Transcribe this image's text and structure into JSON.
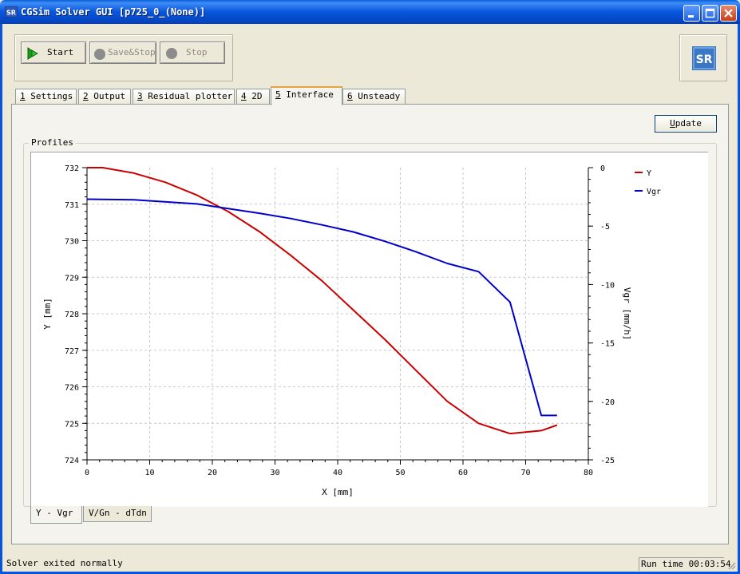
{
  "window": {
    "title": "CGSim Solver GUI [p725_0_(None)]",
    "icon": "stir-logo-icon",
    "colors": {
      "titlebar": "#0855dd",
      "close_button": "#c4401a"
    }
  },
  "toolbar": {
    "start_label": "Start",
    "save_stop_label": "Save&Stop",
    "stop_label": "Stop"
  },
  "tabs": [
    {
      "num": "1",
      "label": " Settings"
    },
    {
      "num": "2",
      "label": " Output"
    },
    {
      "num": "3",
      "label": " Residual plotter"
    },
    {
      "num": "4",
      "label": " 2D"
    },
    {
      "num": "5",
      "label": " Interface"
    },
    {
      "num": "6",
      "label": " Unsteady"
    }
  ],
  "active_tab": "5 Interface",
  "update_button": {
    "first": "U",
    "rest": "pdate"
  },
  "profiles_group": {
    "title": "Profiles"
  },
  "subtabs": [
    {
      "label": "Y - Vgr"
    },
    {
      "label": "V/Gn - dTdn"
    }
  ],
  "status": {
    "message": "Solver exited normally",
    "run_time": "Run time 00:03:54"
  },
  "chart_data": {
    "type": "line",
    "xlabel": "X [mm]",
    "ylabel": "Y [mm]",
    "y2label": "Vgr [mm/h]",
    "xlim": [
      0,
      80
    ],
    "ylim": [
      724,
      732
    ],
    "y2lim": [
      -25,
      0
    ],
    "xticks": [
      "0",
      "10",
      "20",
      "30",
      "40",
      "50",
      "60",
      "70",
      "80"
    ],
    "yticks": [
      "724",
      "725",
      "726",
      "727",
      "728",
      "729",
      "730",
      "731",
      "732"
    ],
    "y2ticks": [
      "0",
      "-5",
      "-10",
      "-15",
      "-20",
      "-25"
    ],
    "grid": true,
    "legend_position": "top-right",
    "series": [
      {
        "name": "Y",
        "axis": "left",
        "color": "#cc0000",
        "x": [
          0,
          2.5,
          7.5,
          12.5,
          17.5,
          22.5,
          27.5,
          32.5,
          37.5,
          42.5,
          47.5,
          52.5,
          57.5,
          62.5,
          67.5,
          72.5,
          75
        ],
        "y": [
          732.0,
          732.0,
          731.85,
          731.6,
          731.25,
          730.8,
          730.25,
          729.6,
          728.9,
          728.1,
          727.3,
          726.45,
          725.6,
          725.0,
          724.72,
          724.8,
          724.95
        ]
      },
      {
        "name": "Vgr",
        "axis": "right",
        "color": "#0000cc",
        "x": [
          0,
          7.5,
          17.5,
          22.5,
          27.5,
          32.5,
          37.5,
          42.5,
          47.5,
          52.5,
          57.5,
          62.5,
          67.5,
          72.5,
          75
        ],
        "y": [
          -2.7,
          -2.75,
          -3.1,
          -3.5,
          -3.9,
          -4.35,
          -4.9,
          -5.5,
          -6.3,
          -7.2,
          -8.2,
          -8.9,
          -11.5,
          -21.2,
          -21.2
        ]
      }
    ]
  }
}
